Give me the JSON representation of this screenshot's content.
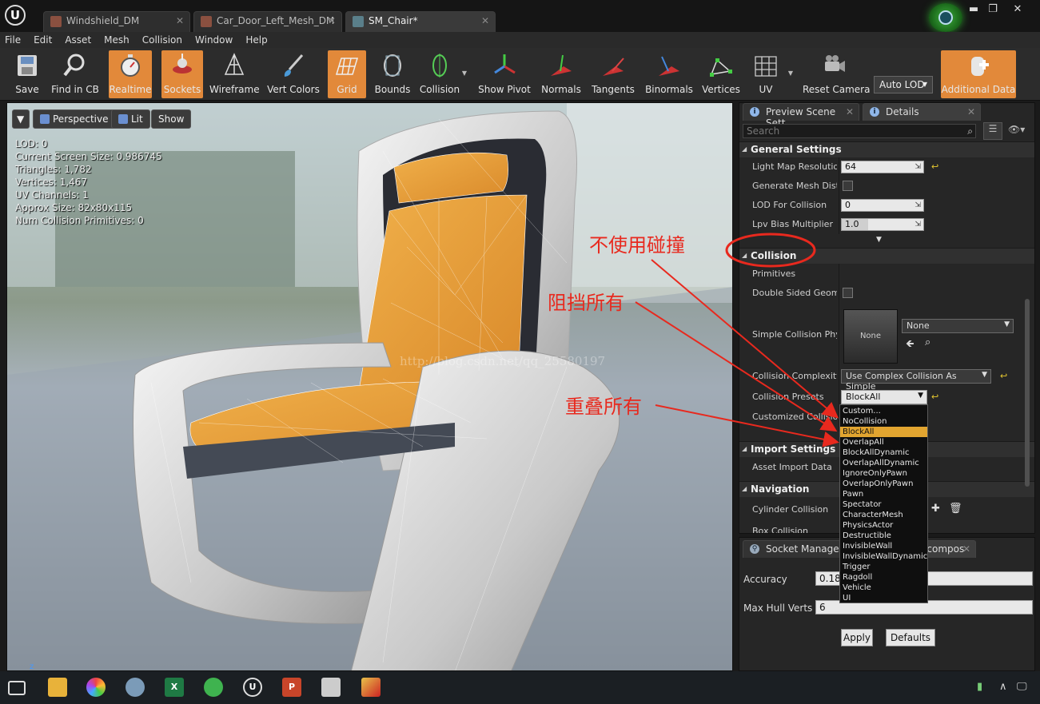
{
  "tabs": [
    {
      "label": "Windshield_DM"
    },
    {
      "label": "Car_Door_Left_Mesh_DM"
    },
    {
      "label": "SM_Chair*"
    }
  ],
  "menu": [
    "File",
    "Edit",
    "Asset",
    "Mesh",
    "Collision",
    "Window",
    "Help"
  ],
  "toolbar": {
    "save": "Save",
    "find_in_cb": "Find in CB",
    "realtime": "Realtime",
    "sockets": "Sockets",
    "wireframe": "Wireframe",
    "vert_colors": "Vert Colors",
    "grid": "Grid",
    "bounds": "Bounds",
    "collision": "Collision",
    "show_pivot": "Show Pivot",
    "normals": "Normals",
    "tangents": "Tangents",
    "binormals": "Binormals",
    "vertices": "Vertices",
    "uv": "UV",
    "reset_camera": "Reset Camera",
    "auto_lod": "Auto LOD",
    "additional_data": "Additional Data"
  },
  "viewport": {
    "perspective": "Perspective",
    "lit": "Lit",
    "show": "Show",
    "stats": [
      "LOD:  0",
      "Current Screen Size:  0.986745",
      "Triangles:  1,782",
      "Vertices:  1,467",
      "UV Channels:  1",
      "Approx Size: 82x80x115",
      "Num Collision Primitives:  0"
    ],
    "watermark": "http://blog.csdn.net/qq_25580197"
  },
  "details": {
    "tab_preview": "Preview Scene Sett",
    "tab_details": "Details",
    "search_placeholder": "Search",
    "general_settings": "General Settings",
    "light_map_resolution_label": "Light Map Resolution",
    "light_map_resolution": "64",
    "generate_mesh_distance_label": "Generate Mesh Dista",
    "lod_for_collision_label": "LOD For Collision",
    "lod_for_collision": "0",
    "lpv_bias_label": "Lpv Bias Multiplier",
    "lpv_bias": "1.0",
    "collision": "Collision",
    "primitives": "Primitives",
    "double_sided_label": "Double Sided Geomet",
    "simple_collision_label": "Simple Collision Phys",
    "simple_collision_thumb": "None",
    "simple_collision_value": "None",
    "collision_complexity_label": "Collision Complexity",
    "collision_complexity": "Use Complex Collision As Simple",
    "collision_presets_label": "Collision Presets",
    "collision_presets": "BlockAll",
    "customized_collision_label": "Customized Collision",
    "import_settings": "Import Settings",
    "asset_import_data": "Asset Import Data",
    "navigation": "Navigation",
    "cylinder_collision": "Cylinder Collision",
    "box_collision": "Box Collision"
  },
  "presets_dropdown": {
    "options": [
      "Custom...",
      "NoCollision",
      "BlockAll",
      "OverlapAll",
      "BlockAllDynamic",
      "OverlapAllDynamic",
      "IgnoreOnlyPawn",
      "OverlapOnlyPawn",
      "Pawn",
      "Spectator",
      "CharacterMesh",
      "PhysicsActor",
      "Destructible",
      "InvisibleWall",
      "InvisibleWallDynamic",
      "Trigger",
      "Ragdoll",
      "Vehicle",
      "UI"
    ],
    "selected": "BlockAll"
  },
  "lower_panel": {
    "tab_socket": "Socket Manager",
    "tab_decomp": "ecompos",
    "accuracy_label": "Accuracy",
    "accuracy": "0.18",
    "max_hull_label": "Max Hull Verts",
    "max_hull": "6",
    "apply": "Apply",
    "defaults": "Defaults"
  },
  "annotations": {
    "no_collision": "不使用碰撞",
    "block_all": "阻挡所有",
    "overlap_all": "重叠所有",
    "color": "#e8291e"
  },
  "colors": {
    "accent_orange": "#e2893a",
    "selection": "#e2a530"
  }
}
